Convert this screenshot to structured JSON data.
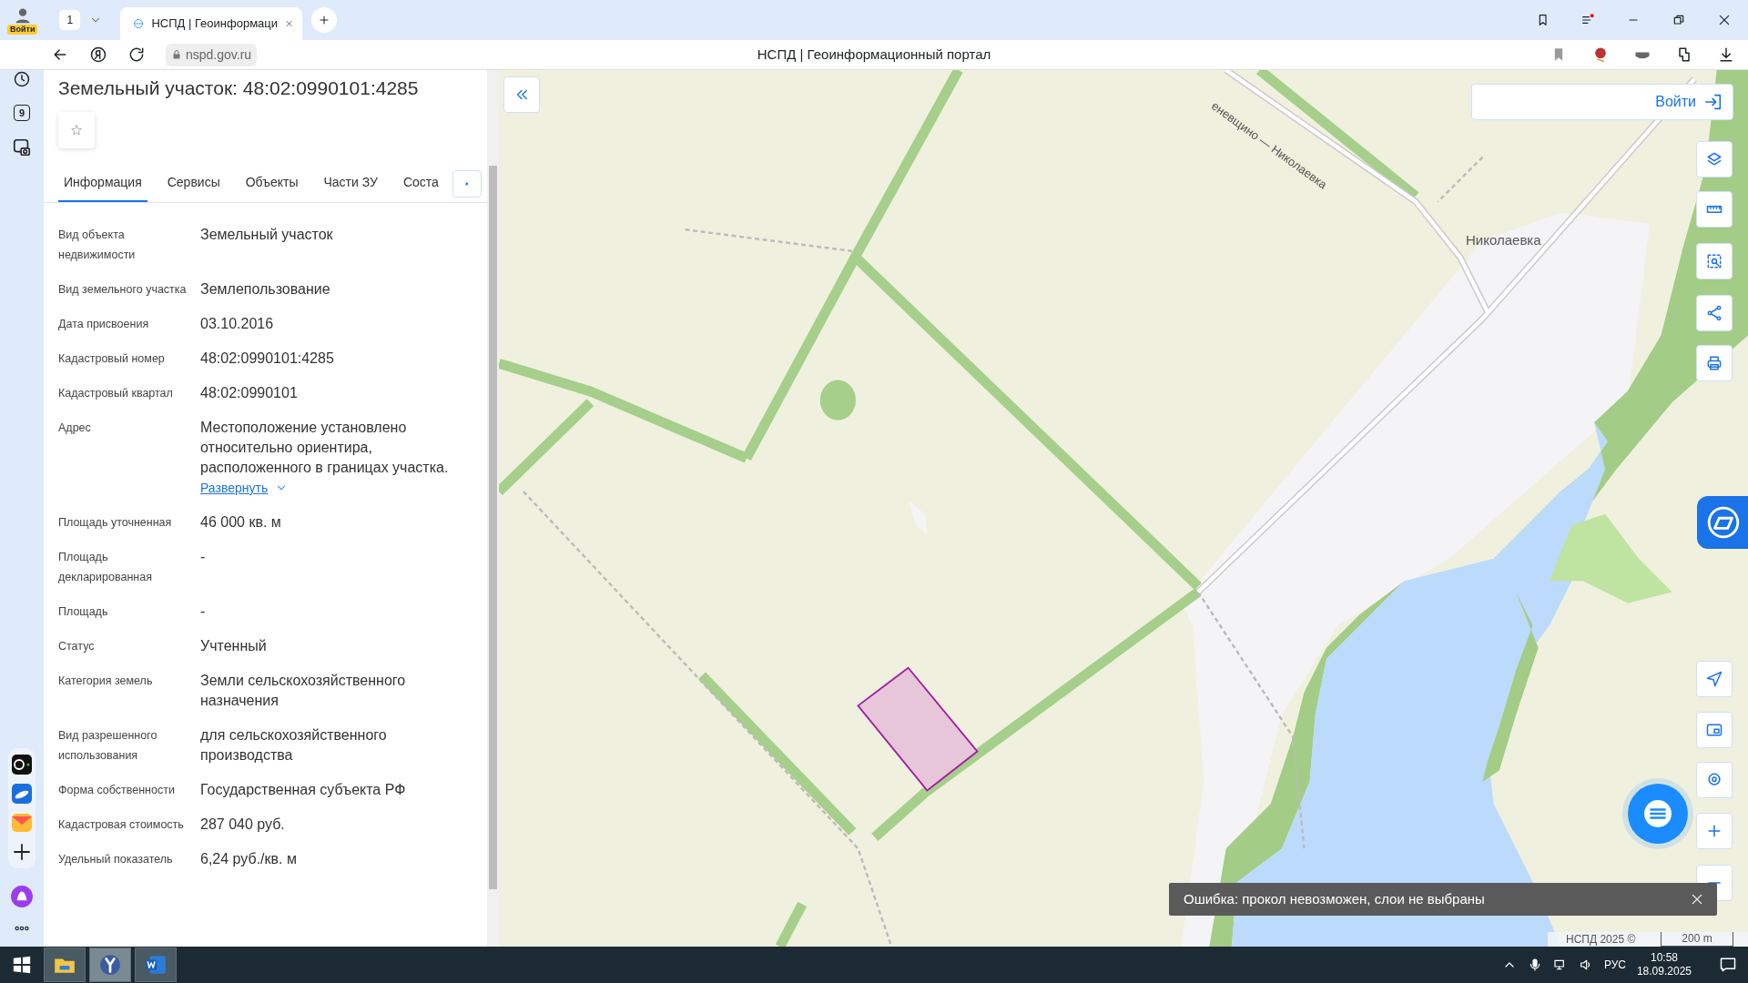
{
  "browser": {
    "profile_label": "Войти",
    "tab_count": "1",
    "tab_title": "НСПД | Геоинформаци",
    "url": "nspd.gov.ru",
    "page_title": "НСПД | Геоинформационный портал",
    "sidebar_badge": "9"
  },
  "panel": {
    "title": "Земельный участок: 48:02:0990101:4285",
    "tabs": [
      {
        "label": "Информация",
        "selected": true
      },
      {
        "label": "Сервисы",
        "selected": false
      },
      {
        "label": "Объекты",
        "selected": false
      },
      {
        "label": "Части ЗУ",
        "selected": false
      },
      {
        "label": "Соста",
        "selected": false
      }
    ],
    "fields": [
      {
        "label": "Вид объекта недвижимости",
        "value": "Земельный участок"
      },
      {
        "label": "Вид земельного участка",
        "value": "Землепользование"
      },
      {
        "label": "Дата присвоения",
        "value": "03.10.2016"
      },
      {
        "label": "Кадастровый номер",
        "value": "48:02:0990101:4285"
      },
      {
        "label": "Кадастровый квартал",
        "value": "48:02:0990101"
      },
      {
        "label": "Адрес",
        "value": "Местоположение установлено относительно ориентира, расположенного в границах участка.",
        "link": "Развернуть"
      },
      {
        "label": "Площадь уточненная",
        "value": "46 000 кв. м"
      },
      {
        "label": "Площадь декларированная",
        "value": "-"
      },
      {
        "label": "Площадь",
        "value": "-"
      },
      {
        "label": "Статус",
        "value": "Учтенный"
      },
      {
        "label": "Категория земель",
        "value": "Земли сельскохозяйственного назначения"
      },
      {
        "label": "Вид разрешенного использования",
        "value": "для сельскохозяйственного производства"
      },
      {
        "label": "Форма собственности",
        "value": "Государственная субъекта РФ"
      },
      {
        "label": "Кадастровая стоимость",
        "value": "287 040 руб."
      },
      {
        "label": "Удельный показатель",
        "value": "6,24 руб./кв. м"
      }
    ]
  },
  "map": {
    "road_label": "еневщино — Николаевка",
    "place_label": "Николаевка",
    "login": "Войти",
    "toast": "Ошибка: прокол невозможен, слои не выбраны",
    "copyright": "НСПД 2025 ©",
    "scale": "200 m"
  },
  "taskbar": {
    "language": "РУС",
    "time": "10:58",
    "date": "18.09.2025"
  }
}
